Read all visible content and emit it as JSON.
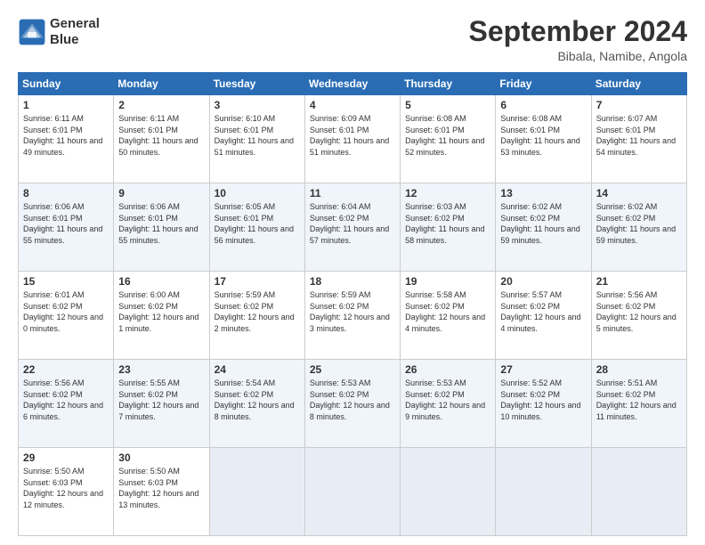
{
  "header": {
    "logo_line1": "General",
    "logo_line2": "Blue",
    "month": "September 2024",
    "location": "Bibala, Namibe, Angola"
  },
  "weekdays": [
    "Sunday",
    "Monday",
    "Tuesday",
    "Wednesday",
    "Thursday",
    "Friday",
    "Saturday"
  ],
  "weeks": [
    [
      {
        "day": "1",
        "sunrise": "Sunrise: 6:11 AM",
        "sunset": "Sunset: 6:01 PM",
        "daylight": "Daylight: 11 hours and 49 minutes."
      },
      {
        "day": "2",
        "sunrise": "Sunrise: 6:11 AM",
        "sunset": "Sunset: 6:01 PM",
        "daylight": "Daylight: 11 hours and 50 minutes."
      },
      {
        "day": "3",
        "sunrise": "Sunrise: 6:10 AM",
        "sunset": "Sunset: 6:01 PM",
        "daylight": "Daylight: 11 hours and 51 minutes."
      },
      {
        "day": "4",
        "sunrise": "Sunrise: 6:09 AM",
        "sunset": "Sunset: 6:01 PM",
        "daylight": "Daylight: 11 hours and 51 minutes."
      },
      {
        "day": "5",
        "sunrise": "Sunrise: 6:08 AM",
        "sunset": "Sunset: 6:01 PM",
        "daylight": "Daylight: 11 hours and 52 minutes."
      },
      {
        "day": "6",
        "sunrise": "Sunrise: 6:08 AM",
        "sunset": "Sunset: 6:01 PM",
        "daylight": "Daylight: 11 hours and 53 minutes."
      },
      {
        "day": "7",
        "sunrise": "Sunrise: 6:07 AM",
        "sunset": "Sunset: 6:01 PM",
        "daylight": "Daylight: 11 hours and 54 minutes."
      }
    ],
    [
      {
        "day": "8",
        "sunrise": "Sunrise: 6:06 AM",
        "sunset": "Sunset: 6:01 PM",
        "daylight": "Daylight: 11 hours and 55 minutes."
      },
      {
        "day": "9",
        "sunrise": "Sunrise: 6:06 AM",
        "sunset": "Sunset: 6:01 PM",
        "daylight": "Daylight: 11 hours and 55 minutes."
      },
      {
        "day": "10",
        "sunrise": "Sunrise: 6:05 AM",
        "sunset": "Sunset: 6:01 PM",
        "daylight": "Daylight: 11 hours and 56 minutes."
      },
      {
        "day": "11",
        "sunrise": "Sunrise: 6:04 AM",
        "sunset": "Sunset: 6:02 PM",
        "daylight": "Daylight: 11 hours and 57 minutes."
      },
      {
        "day": "12",
        "sunrise": "Sunrise: 6:03 AM",
        "sunset": "Sunset: 6:02 PM",
        "daylight": "Daylight: 11 hours and 58 minutes."
      },
      {
        "day": "13",
        "sunrise": "Sunrise: 6:02 AM",
        "sunset": "Sunset: 6:02 PM",
        "daylight": "Daylight: 11 hours and 59 minutes."
      },
      {
        "day": "14",
        "sunrise": "Sunrise: 6:02 AM",
        "sunset": "Sunset: 6:02 PM",
        "daylight": "Daylight: 11 hours and 59 minutes."
      }
    ],
    [
      {
        "day": "15",
        "sunrise": "Sunrise: 6:01 AM",
        "sunset": "Sunset: 6:02 PM",
        "daylight": "Daylight: 12 hours and 0 minutes."
      },
      {
        "day": "16",
        "sunrise": "Sunrise: 6:00 AM",
        "sunset": "Sunset: 6:02 PM",
        "daylight": "Daylight: 12 hours and 1 minute."
      },
      {
        "day": "17",
        "sunrise": "Sunrise: 5:59 AM",
        "sunset": "Sunset: 6:02 PM",
        "daylight": "Daylight: 12 hours and 2 minutes."
      },
      {
        "day": "18",
        "sunrise": "Sunrise: 5:59 AM",
        "sunset": "Sunset: 6:02 PM",
        "daylight": "Daylight: 12 hours and 3 minutes."
      },
      {
        "day": "19",
        "sunrise": "Sunrise: 5:58 AM",
        "sunset": "Sunset: 6:02 PM",
        "daylight": "Daylight: 12 hours and 4 minutes."
      },
      {
        "day": "20",
        "sunrise": "Sunrise: 5:57 AM",
        "sunset": "Sunset: 6:02 PM",
        "daylight": "Daylight: 12 hours and 4 minutes."
      },
      {
        "day": "21",
        "sunrise": "Sunrise: 5:56 AM",
        "sunset": "Sunset: 6:02 PM",
        "daylight": "Daylight: 12 hours and 5 minutes."
      }
    ],
    [
      {
        "day": "22",
        "sunrise": "Sunrise: 5:56 AM",
        "sunset": "Sunset: 6:02 PM",
        "daylight": "Daylight: 12 hours and 6 minutes."
      },
      {
        "day": "23",
        "sunrise": "Sunrise: 5:55 AM",
        "sunset": "Sunset: 6:02 PM",
        "daylight": "Daylight: 12 hours and 7 minutes."
      },
      {
        "day": "24",
        "sunrise": "Sunrise: 5:54 AM",
        "sunset": "Sunset: 6:02 PM",
        "daylight": "Daylight: 12 hours and 8 minutes."
      },
      {
        "day": "25",
        "sunrise": "Sunrise: 5:53 AM",
        "sunset": "Sunset: 6:02 PM",
        "daylight": "Daylight: 12 hours and 8 minutes."
      },
      {
        "day": "26",
        "sunrise": "Sunrise: 5:53 AM",
        "sunset": "Sunset: 6:02 PM",
        "daylight": "Daylight: 12 hours and 9 minutes."
      },
      {
        "day": "27",
        "sunrise": "Sunrise: 5:52 AM",
        "sunset": "Sunset: 6:02 PM",
        "daylight": "Daylight: 12 hours and 10 minutes."
      },
      {
        "day": "28",
        "sunrise": "Sunrise: 5:51 AM",
        "sunset": "Sunset: 6:02 PM",
        "daylight": "Daylight: 12 hours and 11 minutes."
      }
    ],
    [
      {
        "day": "29",
        "sunrise": "Sunrise: 5:50 AM",
        "sunset": "Sunset: 6:03 PM",
        "daylight": "Daylight: 12 hours and 12 minutes."
      },
      {
        "day": "30",
        "sunrise": "Sunrise: 5:50 AM",
        "sunset": "Sunset: 6:03 PM",
        "daylight": "Daylight: 12 hours and 13 minutes."
      },
      null,
      null,
      null,
      null,
      null
    ]
  ]
}
